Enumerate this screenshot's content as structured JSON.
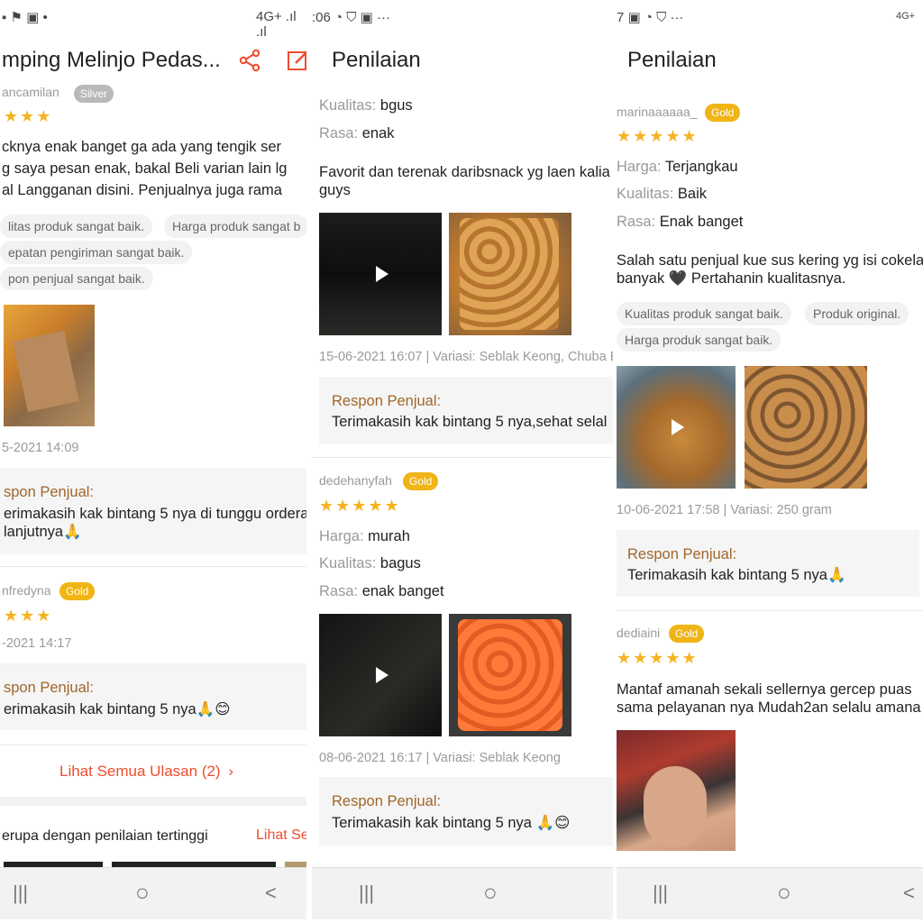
{
  "panel1": {
    "status_left": "▪ ⚑ ▣ •",
    "status_right": "4G+ .ıl .ıl",
    "title": "mping Melinjo Pedas...",
    "reviewer1_name": "ancamilan",
    "reviewer1_badge": "Silver",
    "review1_text": [
      "cknya enak banget ga ada yang tengik ser",
      "g saya pesan enak, bakal Beli varian lain lg",
      "al Langganan disini. Penjualnya juga rama"
    ],
    "chips1": [
      "litas produk sangat baik.",
      "Harga produk sangat b",
      "epatan pengiriman sangat baik.",
      "pon penjual sangat baik."
    ],
    "date1": "5-2021 14:09",
    "resp1_label": "spon Penjual:",
    "resp1_text": [
      "erimakasih kak bintang 5 nya di tunggu orderan",
      "lanjutnya🙏"
    ],
    "reviewer2_name": "nfredyna",
    "reviewer2_badge": "Gold",
    "date2": "-2021 14:17",
    "resp2_label": "spon Penjual:",
    "resp2_text": "erimakasih kak bintang 5 nya🙏😊",
    "see_all": "Lihat Semua Ulasan (2)",
    "similar_label": "erupa dengan penilaian tertinggi",
    "similar_link": "Lihat Se"
  },
  "panel2": {
    "status_left": ":06 ◔ ⛉ ▣ ···",
    "title": "Penilaian",
    "r1_kualitas_label": "Kualitas:",
    "r1_kualitas_val": "bgus",
    "r1_rasa_label": "Rasa:",
    "r1_rasa_val": "enak",
    "r1_text": [
      "Favorit dan terenak daribsnack yg laen kalia",
      "guys"
    ],
    "r1_date": "15-06-2021 16:07 | Variasi: Seblak Keong, Chuba Ba",
    "r1_resp_label": "Respon Penjual:",
    "r1_resp_text": "Terimakasih kak bintang 5 nya,sehat selal",
    "r2_name": "dedehanyfah",
    "r2_badge": "Gold",
    "r2_harga_label": "Harga:",
    "r2_harga_val": "murah",
    "r2_kualitas_label": "Kualitas:",
    "r2_kualitas_val": "bagus",
    "r2_rasa_label": "Rasa:",
    "r2_rasa_val": "enak banget",
    "r2_date": "08-06-2021 16:17 | Variasi: Seblak Keong",
    "r2_resp_label": "Respon Penjual:",
    "r2_resp_text": "Terimakasih kak bintang 5 nya 🙏😊"
  },
  "panel3": {
    "status_left": "7 ▣ ◔ ⛉ ···",
    "status_right": "4G+",
    "title": "Penilaian",
    "r1_name": "marinaaaaaa_",
    "r1_badge": "Gold",
    "r1_harga_label": "Harga:",
    "r1_harga_val": "Terjangkau",
    "r1_kualitas_label": "Kualitas:",
    "r1_kualitas_val": "Baik",
    "r1_rasa_label": "Rasa:",
    "r1_rasa_val": "Enak banget",
    "r1_text": [
      "Salah satu penjual kue sus kering yg isi cokela",
      "banyak 🖤 Pertahanin kualitasnya."
    ],
    "chips": [
      "Kualitas produk sangat baik.",
      "Produk original.",
      "Harga produk sangat baik."
    ],
    "r1_date": "10-06-2021 17:58 | Variasi: 250 gram",
    "r1_resp_label": "Respon Penjual:",
    "r1_resp_text": "Terimakasih kak bintang 5 nya🙏",
    "r2_name": "dediaini",
    "r2_badge": "Gold",
    "r2_text": [
      "Mantaf amanah sekali sellernya gercep puas",
      "sama pelayanan nya Mudah2an selalu amana"
    ]
  },
  "stars": {
    "three": "★★★",
    "five": "★★★★★"
  },
  "icons": {
    "share": "share-icon",
    "edit": "edit-icon",
    "recents": "|||",
    "home": "○",
    "back": "<"
  },
  "colors": {
    "accent": "#ee4d2d",
    "star": "#f5b323",
    "gold_badge": "#f0b414",
    "seller_label": "#a0662a"
  }
}
